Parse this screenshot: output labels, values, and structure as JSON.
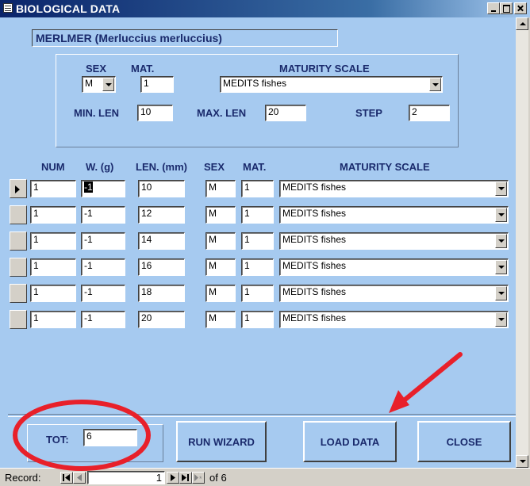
{
  "window": {
    "title": "BIOLOGICAL DATA"
  },
  "species": "MERLMER (Merluccius merluccius)",
  "header": {
    "sex_label": "SEX",
    "mat_label": "MAT.",
    "scale_label": "MATURITY SCALE",
    "sex_value": "M",
    "mat_value": "1",
    "scale_value": "MEDITS fishes",
    "min_len_label": "MIN. LEN",
    "min_len_value": "10",
    "max_len_label": "MAX. LEN",
    "max_len_value": "20",
    "step_label": "STEP",
    "step_value": "2"
  },
  "columns": {
    "num": "NUM",
    "weight": "W. (g)",
    "len": "LEN. (mm)",
    "sex": "SEX",
    "mat": "MAT.",
    "scale": "MATURITY SCALE"
  },
  "rows": [
    {
      "num": "1",
      "w": "-1",
      "len": "10",
      "sex": "M",
      "mat": "1",
      "scale": "MEDITS fishes"
    },
    {
      "num": "1",
      "w": "-1",
      "len": "12",
      "sex": "M",
      "mat": "1",
      "scale": "MEDITS fishes"
    },
    {
      "num": "1",
      "w": "-1",
      "len": "14",
      "sex": "M",
      "mat": "1",
      "scale": "MEDITS fishes"
    },
    {
      "num": "1",
      "w": "-1",
      "len": "16",
      "sex": "M",
      "mat": "1",
      "scale": "MEDITS fishes"
    },
    {
      "num": "1",
      "w": "-1",
      "len": "18",
      "sex": "M",
      "mat": "1",
      "scale": "MEDITS fishes"
    },
    {
      "num": "1",
      "w": "-1",
      "len": "20",
      "sex": "M",
      "mat": "1",
      "scale": "MEDITS fishes"
    }
  ],
  "footer": {
    "tot_label": "TOT:",
    "tot_value": "6",
    "run_wizard": "RUN WIZARD",
    "load_data": "LOAD DATA",
    "close": "CLOSE"
  },
  "record_nav": {
    "label": "Record:",
    "current": "1",
    "of_text": "of 6"
  },
  "colors": {
    "form_bg": "#a6caf0",
    "label_text": "#1a2a6c",
    "annotation_red": "#e8202a"
  }
}
